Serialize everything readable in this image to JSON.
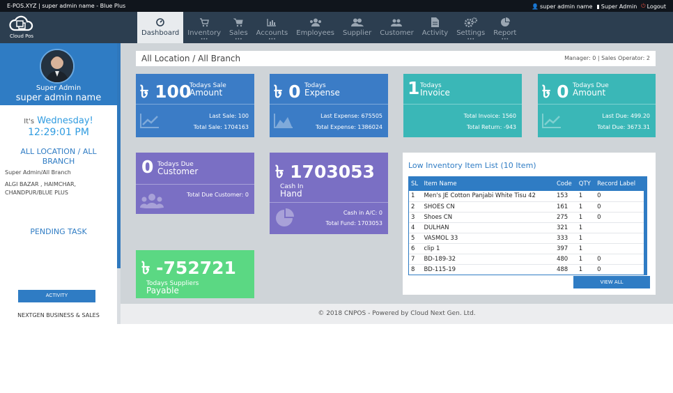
{
  "topbar": {
    "brand": "E-POS.XYZ | super admin name - Blue Plus",
    "user": "super admin name",
    "role": "Super Admin",
    "logout": "Logout"
  },
  "logo": {
    "text": "Cloud Pos"
  },
  "nav": [
    {
      "label": "Dashboard",
      "icon": "dashboard-icon",
      "active": true
    },
    {
      "label": "Inventory",
      "icon": "cart-icon"
    },
    {
      "label": "Sales",
      "icon": "cart-icon"
    },
    {
      "label": "Accounts",
      "icon": "bar-chart-icon"
    },
    {
      "label": "Employees",
      "icon": "users-icon"
    },
    {
      "label": "Supplier",
      "icon": "users-icon"
    },
    {
      "label": "Customer",
      "icon": "users-icon"
    },
    {
      "label": "Activity",
      "icon": "file-icon"
    },
    {
      "label": "Settings",
      "icon": "gears-icon"
    },
    {
      "label": "Report",
      "icon": "pie-chart-icon"
    }
  ],
  "sidebar": {
    "role": "Super Admin",
    "username": "super admin name",
    "its": "It's",
    "day": "Wednesday!",
    "time": "12:29:01 PM",
    "location_title": "ALL LOCATION / ALL BRANCH",
    "location_sub": "Super Admin/All Branch",
    "address": "ALGI BAZAR , HAIMCHAR, CHANDPUR/BLUE PLUS",
    "pending": "PENDING TASK",
    "activity_button": "ACTIVITY",
    "company": "NEXTGEN BUSINESS & SALES"
  },
  "breadcrumb": {
    "text": "All Location / All Branch",
    "stats": "Manager: 0 | Sales Operator: 2"
  },
  "cards": {
    "sale": {
      "value": "৳ 100",
      "label1": "Todays Sale",
      "label2": "Amount",
      "line1": "Last Sale: 100",
      "line2": "Total Sale: 1704163"
    },
    "expense": {
      "value": "৳ 0",
      "label1": "Todays",
      "label2": "Expense",
      "line1": "Last Expense: 675505",
      "line2": "Total Expense: 1386024"
    },
    "invoice": {
      "value": "1",
      "label1": "Todays",
      "label2": "Invoice",
      "line1": "Total Invoice: 1560",
      "line2": "Total Return: -943"
    },
    "due": {
      "value": "৳ 0",
      "label1": "Todays Due",
      "label2": "Amount",
      "line1": "Last Due: 499.20",
      "line2": "Total Due: 3673.31"
    },
    "due_customer": {
      "value": "0",
      "label1": "Todays Due",
      "label2": "Customer",
      "line1": "Total Due Customer: 0"
    },
    "cash": {
      "value": "৳ 1703053",
      "label1": "Cash In",
      "label2": "Hand",
      "line1": "Cash in A/C: 0",
      "line2": "Total Fund: 1703053"
    },
    "payable": {
      "value": "৳ -752721",
      "label1": "Todays Suppliers",
      "label2": "Payable"
    }
  },
  "inventory": {
    "title": "Low Inventory Item List (10 Item)",
    "headers": [
      "SL",
      "Item Name",
      "Code",
      "QTY",
      "Record Label"
    ],
    "rows": [
      [
        "1",
        "Men's JE Cotton Panjabi White Tisu 42",
        "153",
        "1",
        "0"
      ],
      [
        "2",
        "SHOES CN",
        "161",
        "1",
        "0"
      ],
      [
        "3",
        "Shoes CN",
        "275",
        "1",
        "0"
      ],
      [
        "4",
        "DULHAN",
        "321",
        "1",
        ""
      ],
      [
        "5",
        "VASMOL 33",
        "333",
        "1",
        ""
      ],
      [
        "6",
        "clip 1",
        "397",
        "1",
        ""
      ],
      [
        "7",
        "BD-189-32",
        "480",
        "1",
        "0"
      ],
      [
        "8",
        "BD-115-19",
        "488",
        "1",
        "0"
      ]
    ],
    "view_all": "VIEW ALL"
  },
  "footer": "© 2018 CNPOS - Powered by Cloud Next Gen. Ltd."
}
